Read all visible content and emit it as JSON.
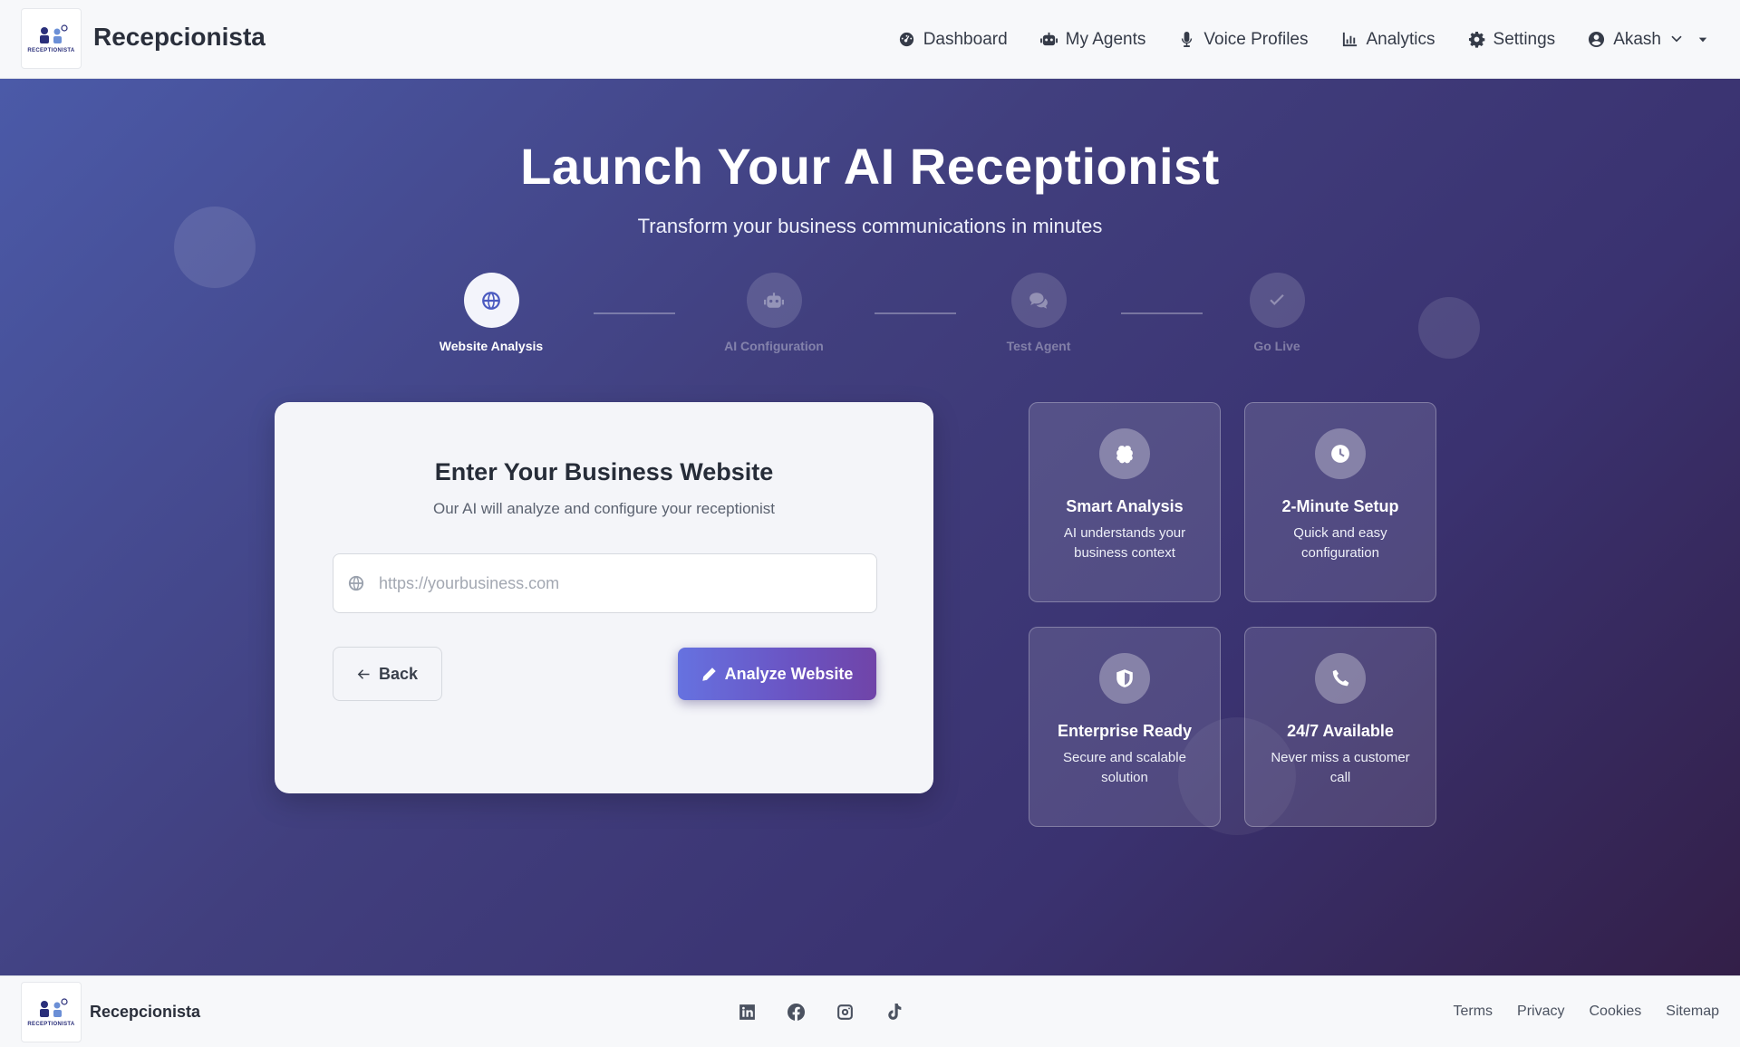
{
  "header": {
    "brand": "Recepcionista",
    "logo_text": "RECEPTIONISTA",
    "nav": [
      {
        "label": "Dashboard",
        "icon": "dashboard-icon"
      },
      {
        "label": "My Agents",
        "icon": "robot-icon"
      },
      {
        "label": "Voice Profiles",
        "icon": "microphone-icon"
      },
      {
        "label": "Analytics",
        "icon": "chart-icon"
      },
      {
        "label": "Settings",
        "icon": "gear-icon"
      }
    ],
    "user": {
      "name": "Akash"
    }
  },
  "hero": {
    "title": "Launch Your AI Receptionist",
    "subtitle": "Transform your business communications in minutes"
  },
  "steps": [
    {
      "label": "Website Analysis",
      "icon": "globe-icon",
      "active": true
    },
    {
      "label": "AI Configuration",
      "icon": "robot-icon",
      "active": false
    },
    {
      "label": "Test Agent",
      "icon": "chat-icon",
      "active": false
    },
    {
      "label": "Go Live",
      "icon": "check-icon",
      "active": false
    }
  ],
  "form": {
    "title": "Enter Your Business Website",
    "subtitle": "Our AI will analyze and configure your receptionist",
    "url_placeholder": "https://yourbusiness.com",
    "url_value": "",
    "back_label": "Back",
    "analyze_label": "Analyze Website"
  },
  "features": [
    {
      "title": "Smart Analysis",
      "desc": "AI understands your business context",
      "icon": "brain-icon"
    },
    {
      "title": "2-Minute Setup",
      "desc": "Quick and easy configuration",
      "icon": "clock-icon"
    },
    {
      "title": "Enterprise Ready",
      "desc": "Secure and scalable solution",
      "icon": "shield-icon"
    },
    {
      "title": "24/7 Available",
      "desc": "Never miss a customer call",
      "icon": "phone-icon"
    }
  ],
  "footer": {
    "brand": "Recepcionista",
    "social": [
      "linkedin-icon",
      "facebook-icon",
      "instagram-icon",
      "tiktok-icon"
    ],
    "links": [
      "Terms",
      "Privacy",
      "Cookies",
      "Sitemap"
    ]
  },
  "colors": {
    "hero_start": "#4b5aa8",
    "hero_end": "#331f48",
    "accent": "#6672e0"
  }
}
